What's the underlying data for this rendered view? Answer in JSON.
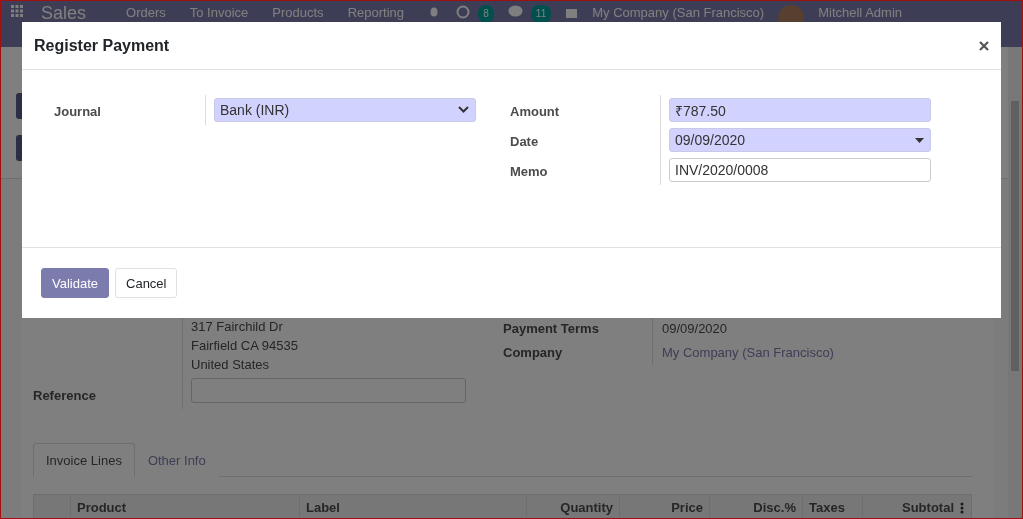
{
  "navbar": {
    "app": "Sales",
    "menu": [
      "Orders",
      "To Invoice",
      "Products",
      "Reporting"
    ],
    "activity_count": "8",
    "message_count": "11",
    "company": "My Company (San Francisco)",
    "user": "Mitchell Admin"
  },
  "invoice": {
    "address_lines": [
      "317 Fairchild Dr",
      "Fairfield CA 94535",
      "United States"
    ],
    "reference_label": "Reference",
    "details": [
      {
        "label": "Payment Terms",
        "value": "09/09/2020",
        "kind": "text"
      },
      {
        "label": "Company",
        "value": "My Company (San Francisco)",
        "kind": "link"
      }
    ]
  },
  "tabs": [
    {
      "label": "Invoice Lines",
      "selected": true
    },
    {
      "label": "Other Info",
      "selected": false
    }
  ],
  "table": {
    "columns": [
      {
        "label": "Product",
        "kind": "text"
      },
      {
        "label": "Label",
        "kind": "text"
      },
      {
        "label": "Quantity",
        "kind": "number"
      },
      {
        "label": "Price",
        "kind": "number"
      },
      {
        "label": "Disc.%",
        "kind": "number"
      },
      {
        "label": "Taxes",
        "kind": "text"
      },
      {
        "label": "Subtotal",
        "kind": "number"
      }
    ]
  },
  "dialog": {
    "title": "Register Payment",
    "left_fields": [
      {
        "label": "Journal",
        "value": "Bank (INR)",
        "kind": "select",
        "required": true
      }
    ],
    "right_fields": [
      {
        "label": "Amount",
        "value": "₹787.50",
        "kind": "text",
        "required": true
      },
      {
        "label": "Date",
        "value": "09/09/2020",
        "kind": "date",
        "required": true
      },
      {
        "label": "Memo",
        "value": "INV/2020/0008",
        "kind": "text",
        "required": false
      }
    ],
    "buttons": [
      {
        "label": "Validate",
        "primary": true
      },
      {
        "label": "Cancel",
        "primary": false
      }
    ]
  }
}
